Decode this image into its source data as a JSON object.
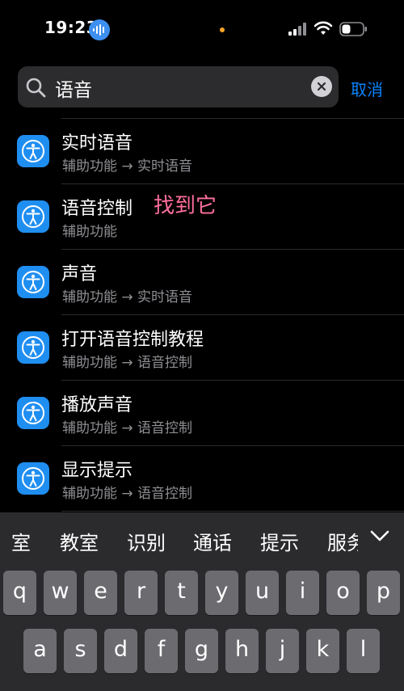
{
  "status_bar": {
    "time": "19:23",
    "audio_indicator_icon": "waveform-icon",
    "privacy_dot_color": "#f5a623"
  },
  "search": {
    "query": "语音",
    "cancel_label": "取消"
  },
  "results": [
    {
      "title": "实时语音",
      "path": "辅助功能 → 实时语音",
      "icon": "accessibility-icon"
    },
    {
      "title": "语音控制",
      "path": "辅助功能",
      "icon": "accessibility-icon",
      "annotation": "找到它"
    },
    {
      "title": "声音",
      "path": "辅助功能 → 实时语音",
      "icon": "accessibility-icon"
    },
    {
      "title": "打开语音控制教程",
      "path": "辅助功能 → 语音控制",
      "icon": "accessibility-icon"
    },
    {
      "title": "播放声音",
      "path": "辅助功能 → 语音控制",
      "icon": "accessibility-icon"
    },
    {
      "title": "显示提示",
      "path": "辅助功能 → 语音控制",
      "icon": "accessibility-icon"
    }
  ],
  "keyboard": {
    "candidates": [
      "室",
      "教室",
      "识别",
      "通话",
      "提示",
      "服务"
    ],
    "row1": [
      "q",
      "w",
      "e",
      "r",
      "t",
      "y",
      "u",
      "i",
      "o",
      "p"
    ],
    "row2": [
      "a",
      "s",
      "d",
      "f",
      "g",
      "h",
      "j",
      "k",
      "l"
    ]
  },
  "colors": {
    "accent": "#0a84ff",
    "icon_bg": "#1f8ef1",
    "annotation": "#ff6f9c"
  }
}
